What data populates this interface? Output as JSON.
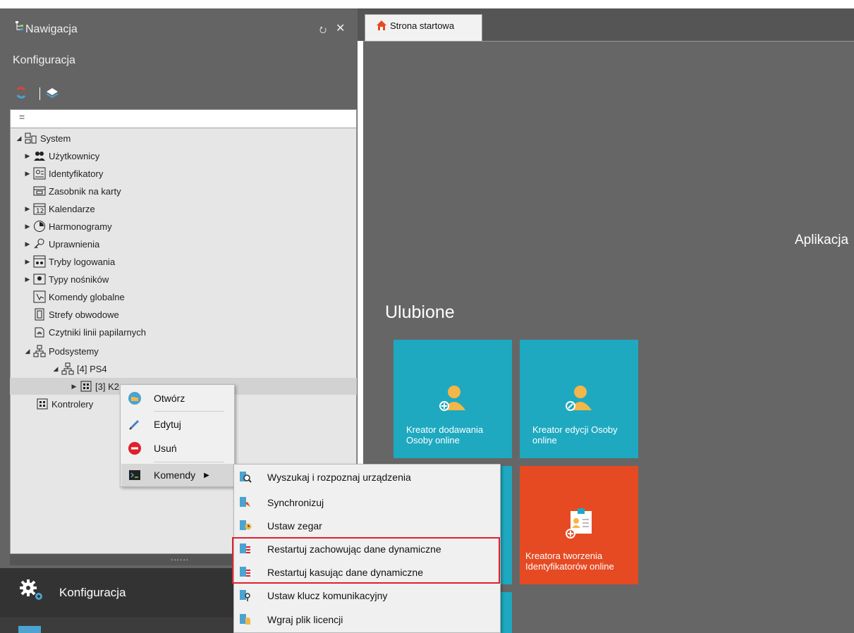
{
  "nav_panel": {
    "title": "Nawigacja",
    "pin_glyph": "⭮",
    "close_glyph": "✕",
    "section_title": "Konfiguracja",
    "filter_glyph": "="
  },
  "tree": {
    "items": [
      {
        "label": "System",
        "icon": "system-icon"
      },
      {
        "label": "Użytkownicy",
        "icon": "users-icon"
      },
      {
        "label": "Identyfikatory",
        "icon": "id-card-icon"
      },
      {
        "label": "Zasobnik na karty",
        "icon": "card-tray-icon"
      },
      {
        "label": "Kalendarze",
        "icon": "calendar-icon"
      },
      {
        "label": "Harmonogramy",
        "icon": "clock-icon"
      },
      {
        "label": "Uprawnienia",
        "icon": "key-icon"
      },
      {
        "label": "Tryby logowania",
        "icon": "login-mode-icon"
      },
      {
        "label": "Typy nośników",
        "icon": "media-type-icon"
      },
      {
        "label": "Komendy globalne",
        "icon": "global-command-icon"
      },
      {
        "label": "Strefy obwodowe",
        "icon": "zone-icon"
      },
      {
        "label": "Czytniki linii papilarnych",
        "icon": "fingerprint-icon"
      },
      {
        "label": "Podsystemy",
        "icon": "subsystem-icon"
      },
      {
        "label": "[4] PS4",
        "icon": "subsystem-icon"
      },
      {
        "label": "[3] K2",
        "icon": "controller-icon"
      },
      {
        "label": "Kontrolery",
        "icon": "controller-icon"
      }
    ]
  },
  "splitter_glyph": "......",
  "bottom_nav": {
    "label": "Konfiguracja"
  },
  "tabs": [
    {
      "label": "Strona startowa"
    }
  ],
  "main": {
    "aplikacja_label": "Aplikacja",
    "favorites_title": "Ulubione",
    "tiles": [
      {
        "label": "Kreator dodawania Osoby online",
        "color": "#1ea9c0"
      },
      {
        "label": "Kreator edycji Osoby online",
        "color": "#1ea9c0"
      },
      {
        "label": "Kreatora tworzenia Identyfikatorów online",
        "color": "#e64a22"
      }
    ]
  },
  "context_menu": {
    "items": [
      {
        "label": "Otwórz"
      },
      {
        "label": "Edytuj"
      },
      {
        "label": "Usuń"
      },
      {
        "label": "Komendy"
      }
    ],
    "submenu_arrow": "▶"
  },
  "submenu": {
    "items": [
      {
        "label": "Wyszukaj i rozpoznaj urządzenia"
      },
      {
        "label": "Synchronizuj"
      },
      {
        "label": "Ustaw zegar"
      },
      {
        "label": "Restartuj zachowując dane dynamiczne"
      },
      {
        "label": "Restartuj kasując dane dynamiczne"
      },
      {
        "label": "Ustaw klucz komunikacyjny"
      },
      {
        "label": "Wgraj plik licencji"
      }
    ],
    "highlight_color": "#e0202c"
  }
}
